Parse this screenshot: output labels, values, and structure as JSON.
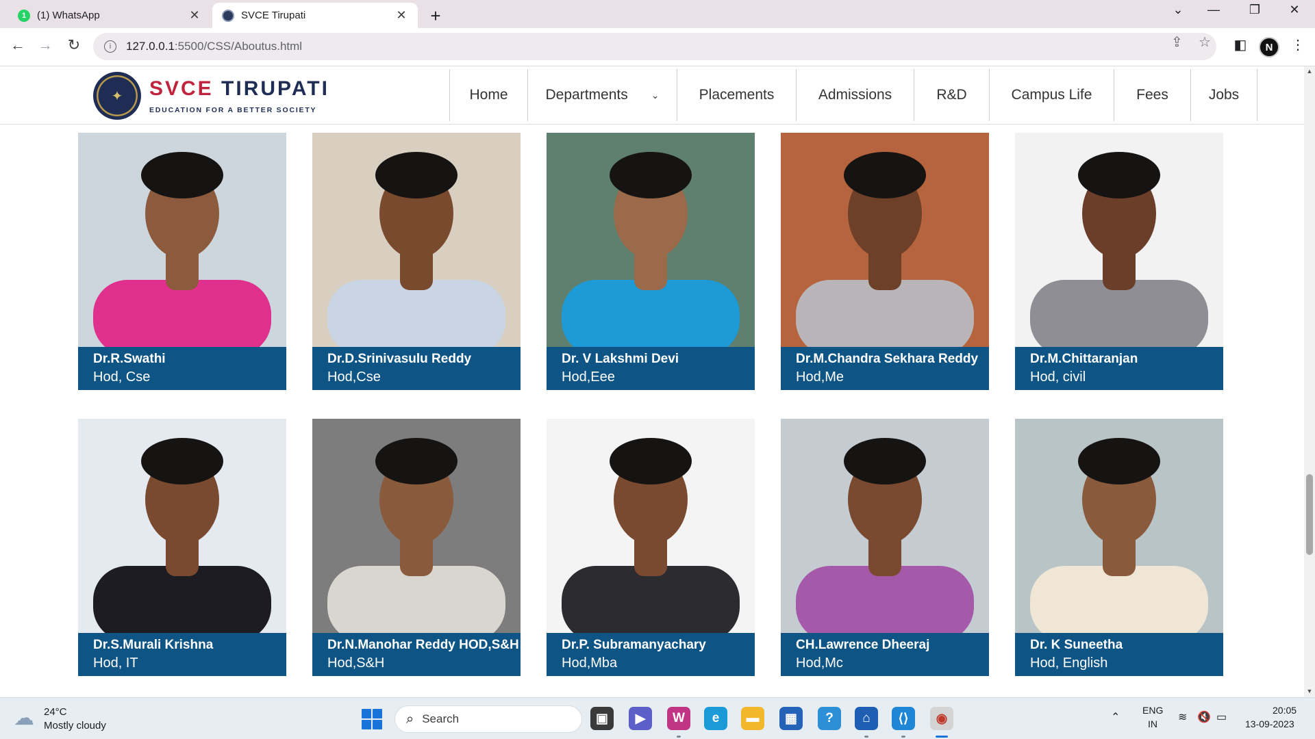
{
  "browser": {
    "tabs": [
      {
        "title": "(1) WhatsApp",
        "badge": "1",
        "active": false
      },
      {
        "title": "SVCE Tirupati",
        "active": true
      }
    ],
    "url_host": "127.0.0.1",
    "url_path": ":5500/CSS/Aboutus.html",
    "profile_initial": "N"
  },
  "site": {
    "brand_primary": "SVCE",
    "brand_secondary": "TIRUPATI",
    "tagline": "EDUCATION FOR A BETTER SOCIETY",
    "nav": [
      "Home",
      "Departments",
      "Placements",
      "Admissions",
      "R&D",
      "Campus Life",
      "Fees",
      "Jobs"
    ],
    "caption_color": "#0e5585"
  },
  "faculty": [
    {
      "name": "Dr.R.Swathi",
      "role": "Hod, Cse",
      "bg": "#cdd6dd",
      "shirt": "#e0308e",
      "skin": "#8c5a3c"
    },
    {
      "name": "Dr.D.Srinivasulu Reddy",
      "role": "Hod,Cse",
      "bg": "#d8cfc0",
      "shirt": "#c9d4e4",
      "skin": "#7a4a2e"
    },
    {
      "name": "Dr. V Lakshmi Devi",
      "role": "Hod,Eee",
      "bg": "#5f7f6f",
      "shirt": "#1e9ad6",
      "skin": "#9a6a4a"
    },
    {
      "name": "Dr.M.Chandra Sekhara Reddy",
      "role": "Hod,Me",
      "bg": "#b5643e",
      "shirt": "#b9b4b8",
      "skin": "#6e4028"
    },
    {
      "name": "Dr.M.Chittaranjan",
      "role": "Hod, civil",
      "bg": "#f2f2f2",
      "shirt": "#8e8e94",
      "skin": "#6a3e28"
    },
    {
      "name": "Dr.S.Murali Krishna",
      "role": "Hod, IT",
      "bg": "#e4eaf0",
      "shirt": "#1c1c22",
      "skin": "#7a4a30"
    },
    {
      "name": "Dr.N.Manohar Reddy HOD,S&H",
      "role": "Hod,S&H",
      "bg": "#7d7d7d",
      "shirt": "#d9d6d0",
      "skin": "#8a5a3c"
    },
    {
      "name": "Dr.P. Subramanyachary",
      "role": "Hod,Mba",
      "bg": "#f4f4f4",
      "shirt": "#2c2c30",
      "skin": "#7a4a30"
    },
    {
      "name": "CH.Lawrence Dheeraj",
      "role": "Hod,Mc",
      "bg": "#c4ccd2",
      "shirt": "#a45aa8",
      "skin": "#7a4a30"
    },
    {
      "name": "Dr. K Suneetha",
      "role": "Hod, English",
      "bg": "#b9c4c7",
      "shirt": "#efe6d6",
      "skin": "#8a5a3c"
    }
  ],
  "taskbar": {
    "temperature": "24°C",
    "weather": "Mostly cloudy",
    "search_placeholder": "Search",
    "lang": "ENG",
    "region": "IN",
    "time": "20:05",
    "date": "13-09-2023"
  }
}
